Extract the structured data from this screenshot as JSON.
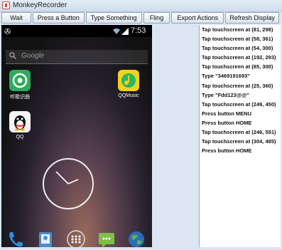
{
  "window": {
    "title": "MonkeyRecorder"
  },
  "toolbar": {
    "buttons": [
      "Wait",
      "Press a Button",
      "Type Something",
      "Fling",
      "Export Actions",
      "Refresh Display"
    ]
  },
  "device": {
    "status_time": "7:53",
    "search_placeholder": "Google",
    "apps": [
      {
        "label": "听歌识曲",
        "icon": "music-recognition-icon",
        "color": "#2eab5c"
      },
      {
        "label": "QQMusic",
        "icon": "qqmusic-icon",
        "color": "#f3d21c"
      },
      {
        "label": "QQ",
        "icon": "qq-penguin-icon",
        "color": "#f4f4f4"
      }
    ],
    "dock": [
      "phone-icon",
      "contacts-icon",
      "app-drawer-icon",
      "messaging-icon",
      "browser-icon"
    ]
  },
  "log": [
    "Tap touchscreen at (81, 298)",
    "Tap touchscreen at (58, 361)",
    "Tap touchscreen at (54, 300)",
    "Tap touchscreen at (192, 293)",
    "Tap touchscreen at (85, 300)",
    "Type \"3469191693\"",
    "Tap touchscreen at (25, 360)",
    "Type \"Fdd123@@\"",
    "Tap touchscreen at (249, 450)",
    "Press button MENU",
    "Press button HOME",
    "Tap touchscreen at (246, 551)",
    "Tap touchscreen at (304, 485)",
    "Press button HOME"
  ]
}
